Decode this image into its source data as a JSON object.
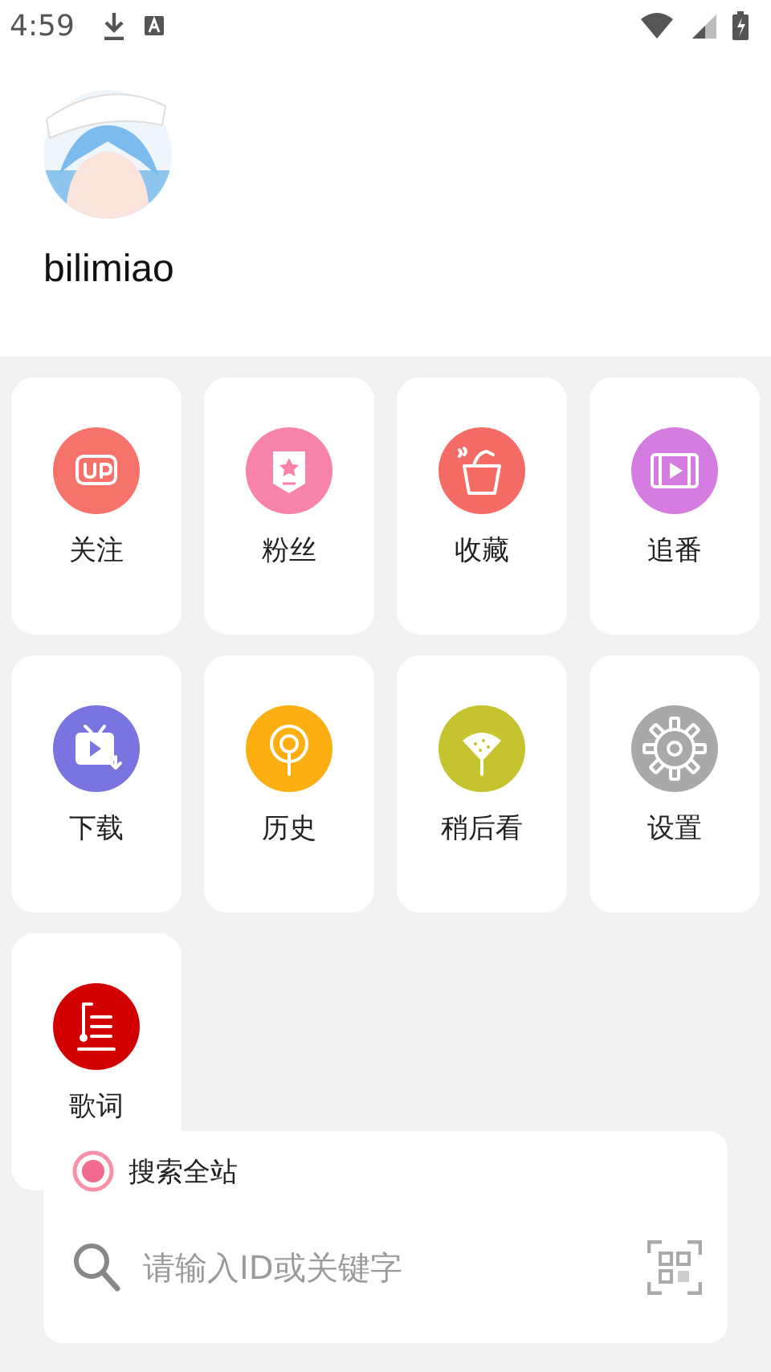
{
  "status_bar": {
    "time": "4:59"
  },
  "profile": {
    "username": "bilimiao"
  },
  "menu": [
    {
      "label": "关注",
      "kind": "up",
      "color": "#f5736b"
    },
    {
      "label": "粉丝",
      "kind": "badge",
      "color": "#f883a8"
    },
    {
      "label": "收藏",
      "kind": "bucket",
      "color": "#f56c66"
    },
    {
      "label": "追番",
      "kind": "film",
      "color": "#d47ce0"
    },
    {
      "label": "下载",
      "kind": "tv",
      "color": "#7a74e0"
    },
    {
      "label": "历史",
      "kind": "podcast",
      "color": "#fdaf12"
    },
    {
      "label": "稍后看",
      "kind": "popsicle",
      "color": "#c6c42e"
    },
    {
      "label": "设置",
      "kind": "gear",
      "color": "#a9a9a9"
    },
    {
      "label": "歌词",
      "kind": "lyrics",
      "color": "#d20000"
    }
  ],
  "search": {
    "scope": {
      "label": "搜索全站",
      "selected": true
    },
    "placeholder": "请输入ID或关键字"
  }
}
